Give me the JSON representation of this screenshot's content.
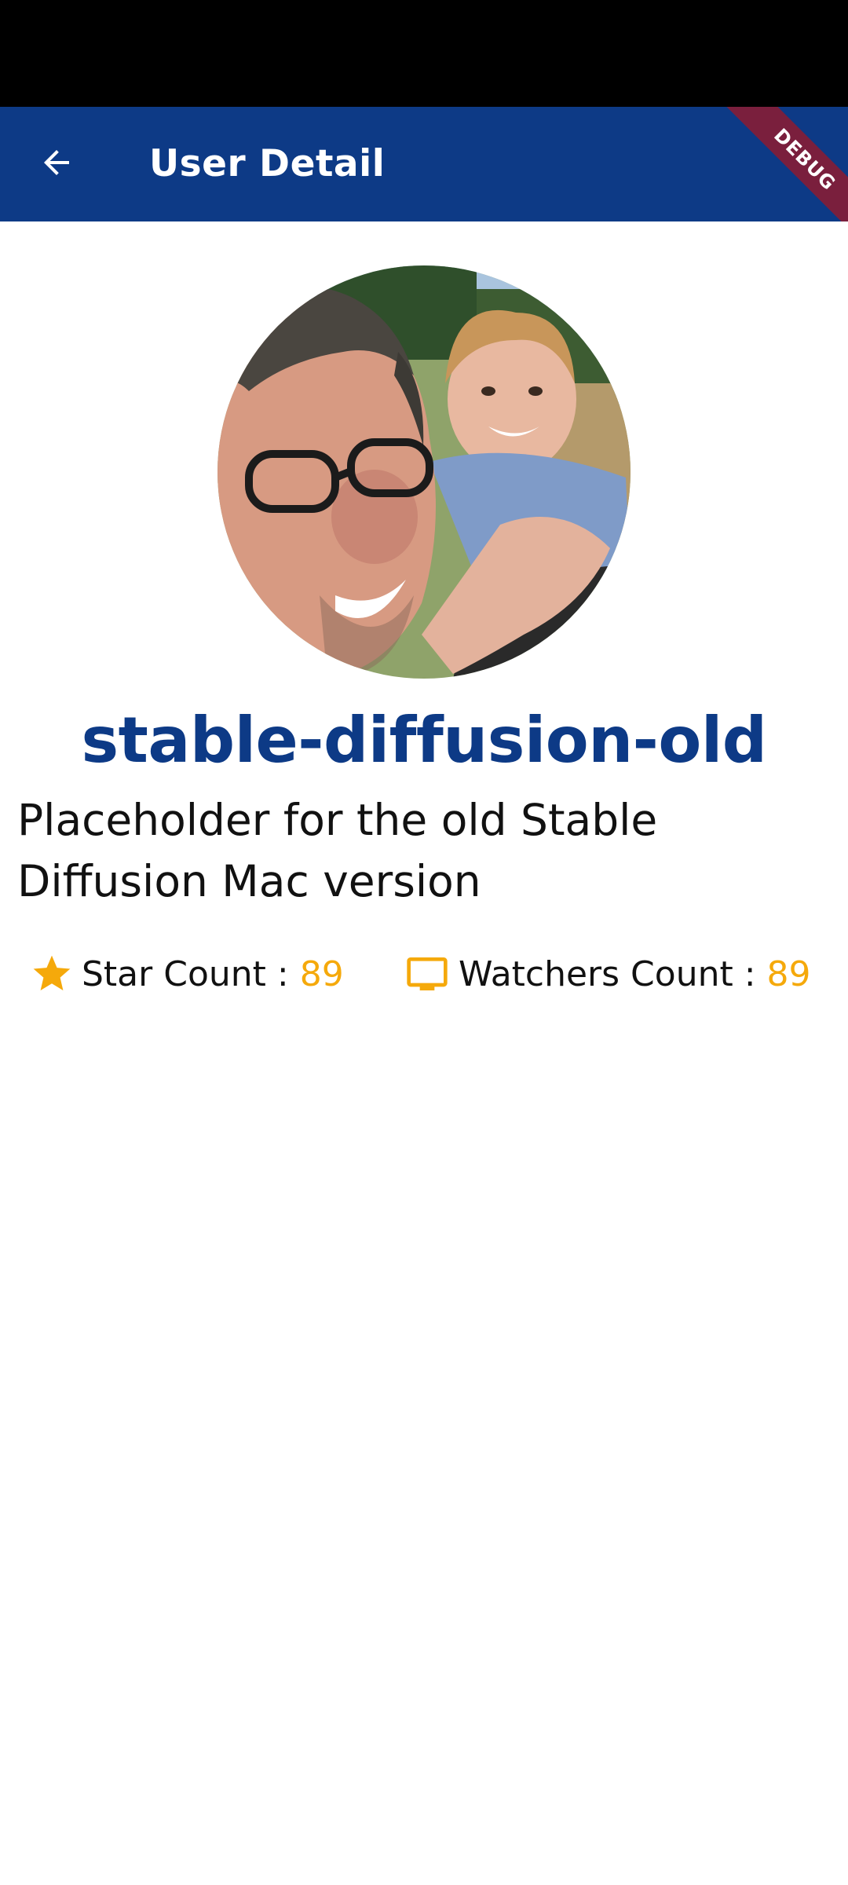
{
  "app_bar": {
    "title": "User Detail",
    "back_icon": "arrow-back-icon",
    "color": "#0d3a86",
    "debug_banner": "DEBUG"
  },
  "profile": {
    "avatar": "user-avatar-photo",
    "name": "stable-diffusion-old",
    "description": "Placeholder for the old Stable Diffusion Mac version"
  },
  "stats": {
    "star_icon": "star-icon",
    "star_label": "Star Count :",
    "star_value": "89",
    "watchers_icon": "monitor-icon",
    "watchers_label": "Watchers Count :",
    "watchers_value": "89",
    "accent_color": "#f5a90b"
  }
}
